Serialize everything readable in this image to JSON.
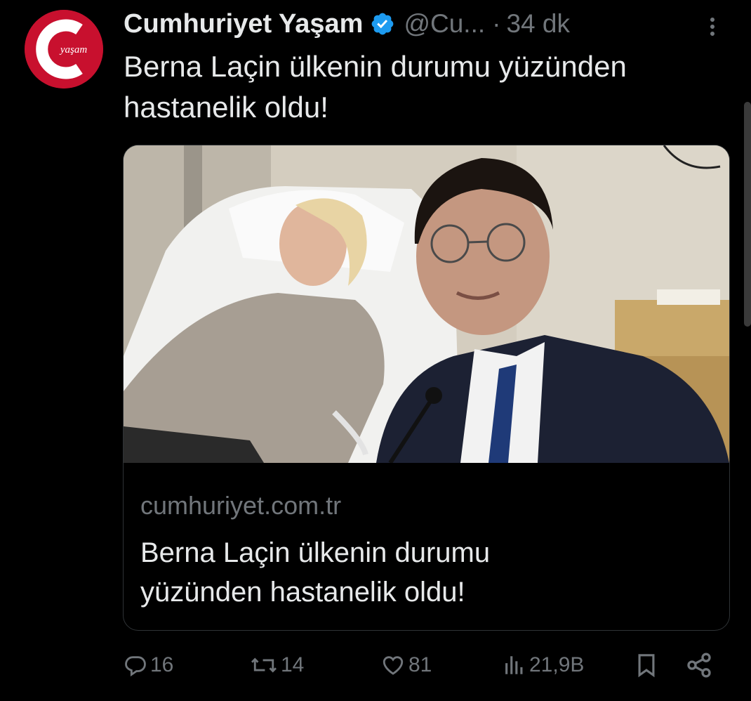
{
  "account": {
    "display_name": "Cumhuriyet Yaşam",
    "handle": "@Cu...",
    "separator": "·",
    "time": "34 dk",
    "avatar_text": "yaşam",
    "verified": true
  },
  "tweet": {
    "line1": "Berna Laçin ülkenin durumu yüzünden",
    "line2": "hastanelik oldu!"
  },
  "card": {
    "domain": "cumhuriyet.com.tr",
    "title_line1": "Berna Laçin ülkenin durumu",
    "title_line2": "yüzünden hastanelik oldu!",
    "image_description_icon": "photo"
  },
  "actions": {
    "replies": "16",
    "reposts": "14",
    "likes": "81",
    "views": "21,9B"
  },
  "icons": {
    "reply": "reply-icon",
    "repost": "repost-icon",
    "like": "heart-icon",
    "views": "views-icon",
    "bookmark": "bookmark-icon",
    "share": "share-icon",
    "more": "more-icon",
    "verified": "verified-badge-icon"
  },
  "colors": {
    "background": "#000000",
    "text": "#e7e9ea",
    "secondary": "#71767b",
    "brand": "#c8102e",
    "verified": "#1d9bf0"
  }
}
